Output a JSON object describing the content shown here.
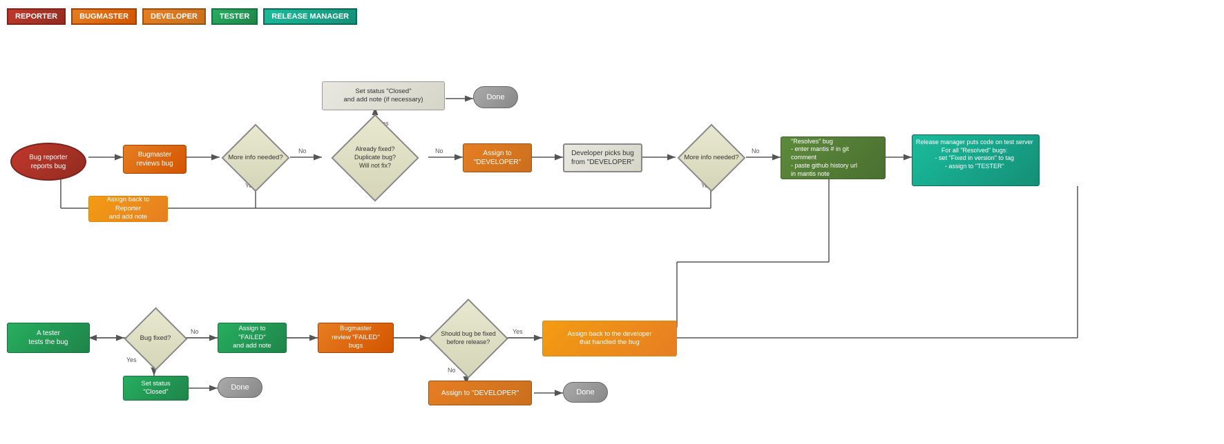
{
  "legend": {
    "items": [
      {
        "label": "REPORTER",
        "class": "legend-reporter"
      },
      {
        "label": "BUGMASTER",
        "class": "legend-bugmaster"
      },
      {
        "label": "DEVELOPER",
        "class": "legend-developer"
      },
      {
        "label": "TESTER",
        "class": "legend-tester"
      },
      {
        "label": "RELEASE MANAGER",
        "class": "legend-release"
      }
    ]
  },
  "nodes": {
    "bug_reporter": "Bug reporter\nreports bug",
    "bugmaster_reviews": "Bugmaster\nreviews bug",
    "more_info_1": "More info needed?",
    "already_fixed": "Already fixed?\nDuplicate bug?\nWill not fix?",
    "set_closed_top": "Set status \"Closed\"\nand add note (if necessary)",
    "done_top": "Done",
    "assign_developer": "Assign to \"DEVELOPER\"",
    "developer_picks": "Developer picks bug\nfrom \"DEVELOPER\"",
    "more_info_2": "More info needed?",
    "resolves_bug": "\"Resolves\" bug\n- enter mantis # in git comment\n- paste github history url\n  in mantis note",
    "assign_reporter": "Assign back to Reporter\nand add note",
    "release_manager": "Release manager puts code on test server\nFor all \"Resolved\" bugs:\n- set \"Fixed in version\" to tag\n- assign to \"TESTER\"",
    "tester_tests": "A tester\ntests the bug",
    "bug_fixed": "Bug fixed?",
    "assign_failed": "Assign to \"FAILED\"\nand add note",
    "bugmaster_failed": "Bugmaster\nreview \"FAILED\" bugs",
    "should_fix": "Should bug be fixed\nbefore release?",
    "assign_back_dev": "Assign back to the developer\nthat handled the bug",
    "set_closed_bottom": "Set status \"Closed\"",
    "done_bottom_left": "Done",
    "assign_developer_bottom": "Assign to \"DEVELOPER\"",
    "done_bottom_right": "Done"
  },
  "labels": {
    "yes": "Yes",
    "no": "No"
  }
}
